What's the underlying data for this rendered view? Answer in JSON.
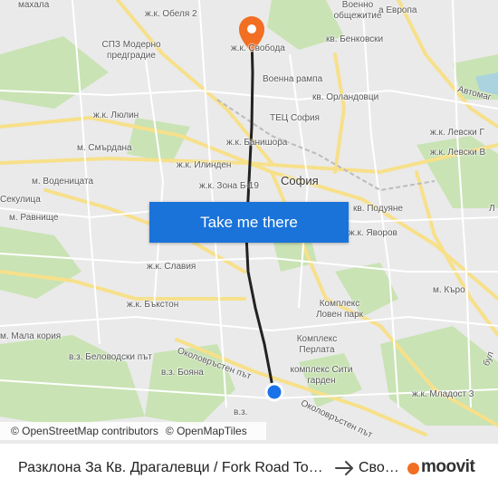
{
  "map": {
    "labels": {
      "mahala": "махала",
      "obelya2": "ж.к. Обеля 2",
      "student": "Военно общежитие",
      "evropa": "а Европа",
      "spz": "СПЗ Модерно предградие",
      "svoboda": "ж.к. Свобода",
      "benkovski": "кв. Бенковски",
      "voenna": "Военна рампа",
      "orlandovtsi": "кв. Орландовци",
      "avtomag": "Автомаг",
      "lyulin": "ж.к. Люлин",
      "tets": "ТЕЦ София",
      "levski_g": "ж.к. Левски Г",
      "banishora": "ж.к. Банишора",
      "smardana": "м. Смърдана",
      "ilinden": "ж.к. Илинден",
      "levski_v": "ж.к. Левски В",
      "vodenitsata": "м. Воденицата",
      "sofia": "София",
      "sekulitsa": "Секулица",
      "zona": "ж.к. Зона Б-19",
      "ravnishte": "м. Равнище",
      "podue": "кв. Подуяне",
      "l": "Л",
      "yavorov": "ж.к. Яворов",
      "slaviya": "ж.к. Славия",
      "karo": "м. Къро",
      "buxton": "ж.к. Бъкстон",
      "lovenpark": "Комплекс Ловен парк",
      "perlata": "Комплекс Перлата",
      "malakoria": "м. Мала кория",
      "okolovrasten1": "Околовръстен път",
      "belovodski": "в.з. Беловодски път",
      "boyana": "в.з. Бояна",
      "sitigarden": "комплекс Сити гарден",
      "mladost3": "ж.к. Младост 3",
      "okolovrasten2": "Околовръстен път",
      "vz": "в.з.",
      "bul": "бул"
    }
  },
  "cta": {
    "label": "Take me there"
  },
  "attribution": {
    "osm": "© OpenStreetMap contributors",
    "omt": "© OpenMapTiles"
  },
  "route": {
    "from": "Разклона За Кв. Драгалевци / Fork Road To Dragalevtsi Qr.",
    "to": "Свобода"
  },
  "brand": {
    "name": "moovit"
  },
  "colors": {
    "route_line": "#222222",
    "origin_dot": "#1a73e8",
    "destination_pin": "#f26e22",
    "cta_bg": "#1a73d9",
    "brand_orange": "#f26e22"
  }
}
